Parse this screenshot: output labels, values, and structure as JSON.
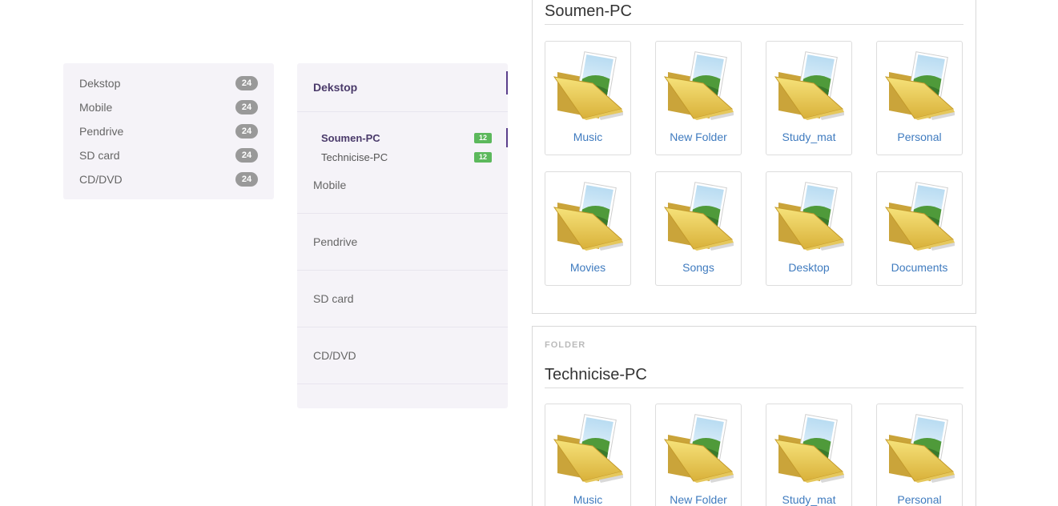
{
  "left_list": {
    "items": [
      {
        "label": "Dekstop",
        "count": "24"
      },
      {
        "label": "Mobile",
        "count": "24"
      },
      {
        "label": "Pendrive",
        "count": "24"
      },
      {
        "label": "SD card",
        "count": "24"
      },
      {
        "label": "CD/DVD",
        "count": "24"
      }
    ]
  },
  "mid_list": {
    "top_label": "Dekstop",
    "sub_items": [
      {
        "label": "Soumen-PC",
        "count": "12"
      },
      {
        "label": "Technicise-PC",
        "count": "12"
      }
    ],
    "mobile_label": "Mobile",
    "rows": [
      "Pendrive",
      "SD card",
      "CD/DVD"
    ]
  },
  "panel1": {
    "title": "Soumen-PC",
    "folders": [
      "Music",
      "New Folder",
      "Study_mat",
      "Personal",
      "Movies",
      "Songs",
      "Desktop",
      "Documents"
    ]
  },
  "panel2": {
    "tag": "FOLDER",
    "title": "Technicise-PC",
    "folders": [
      "Music",
      "New Folder",
      "Study_mat",
      "Personal"
    ]
  },
  "colors": {
    "accent": "#5b3f8c",
    "link": "#3f7bbf",
    "badge_gray": "#999999",
    "badge_green": "#5cb85c",
    "list_bg": "#f5f3f8"
  },
  "icons": {
    "folder": "folder-icon"
  }
}
